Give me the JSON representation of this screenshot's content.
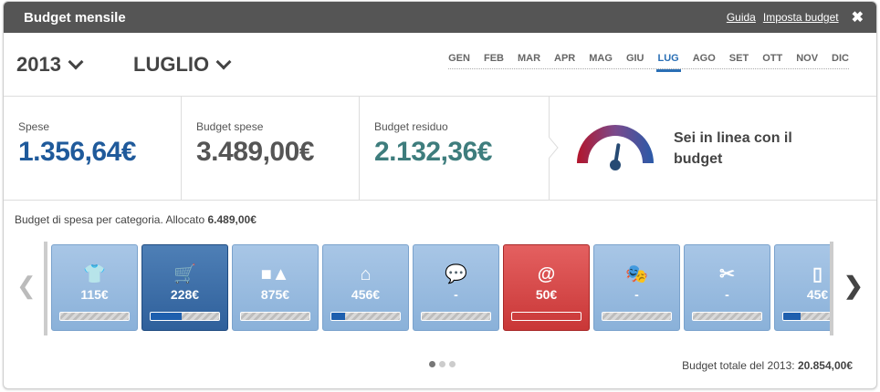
{
  "header": {
    "title": "Budget mensile",
    "help_link": "Guida",
    "setup_link": "Imposta budget"
  },
  "date": {
    "year": "2013",
    "month": "LUGLIO",
    "months": [
      "GEN",
      "FEB",
      "MAR",
      "APR",
      "MAG",
      "GIU",
      "LUG",
      "AGO",
      "SET",
      "OTT",
      "NOV",
      "DIC"
    ],
    "active_month": "LUG"
  },
  "stats": {
    "spese": {
      "label": "Spese",
      "value": "1.356,64€"
    },
    "budget_spese": {
      "label": "Budget spese",
      "value": "3.489,00€"
    },
    "budget_residuo": {
      "label": "Budget residuo",
      "value": "2.132,36€"
    },
    "status": "Sei in linea con il budget",
    "gauge_level": 0.55
  },
  "categories": {
    "label": "Budget di spesa per categoria. Allocato",
    "allocated": "6.489,00€",
    "items": [
      {
        "icon": "shirt-icon",
        "amount": "115€",
        "style": "light",
        "progress": 0
      },
      {
        "icon": "cart-icon",
        "amount": "228€",
        "style": "dark",
        "progress": 0.45
      },
      {
        "icon": "shapes-icon",
        "amount": "875€",
        "style": "light",
        "progress": 0
      },
      {
        "icon": "house-icon",
        "amount": "456€",
        "style": "light",
        "progress": 0.2
      },
      {
        "icon": "chat-icon",
        "amount": "-",
        "style": "light",
        "progress": 0
      },
      {
        "icon": "mail-at-icon",
        "amount": "50€",
        "style": "red",
        "progress": 0
      },
      {
        "icon": "theater-masks-icon",
        "amount": "-",
        "style": "light",
        "progress": 0
      },
      {
        "icon": "tools-icon",
        "amount": "-",
        "style": "light",
        "progress": 0
      },
      {
        "icon": "phone-icon",
        "amount": "45€",
        "style": "light",
        "progress": 0.25
      }
    ],
    "pages": 3,
    "active_page": 1
  },
  "footer": {
    "total_label": "Budget totale del 2013:",
    "total_value": "20.854,00€"
  },
  "colors": {
    "header_bg": "#555555",
    "primary_blue": "#1f5a9b",
    "accent_blue": "#2a6fb5",
    "teal": "#3e7d7d",
    "alert_red": "#c93737"
  }
}
